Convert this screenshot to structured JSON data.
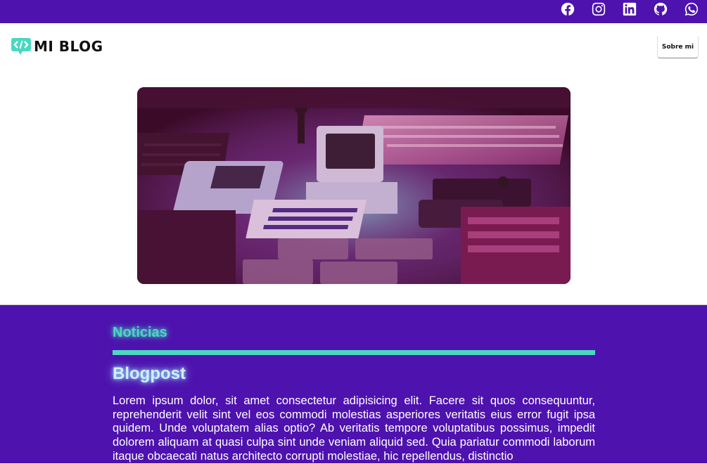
{
  "topbar": {
    "social": [
      {
        "name": "facebook-icon"
      },
      {
        "name": "instagram-icon"
      },
      {
        "name": "linkedin-icon"
      },
      {
        "name": "github-icon"
      },
      {
        "name": "whatsapp-icon"
      }
    ]
  },
  "header": {
    "logo_text": "MI BLOG",
    "nav_button": "Sobre mi"
  },
  "hero": {
    "image_desc": "retro computers and consoles"
  },
  "main": {
    "section_title": "Noticias",
    "post": {
      "title": "Blogpost",
      "body": "Lorem ipsum dolor, sit amet consectetur adipisicing elit. Facere sit quos consequuntur, reprehenderit velit sint vel eos commodi molestias asperiores veritatis eius error fugit ipsa quidem. Unde voluptatem alias optio? Ab veritatis tempore voluptatibus possimus, impedit dolorem aliquam at quasi culpa sint unde veniam aliquid sed. Quia pariatur commodi laborum itaque obcaecati natus architecto corrupti molestiae, hic repellendus, distinctio"
    }
  },
  "colors": {
    "purple": "#4e12ae",
    "teal": "#49d8c0",
    "glow_blue": "#9be8ff"
  }
}
